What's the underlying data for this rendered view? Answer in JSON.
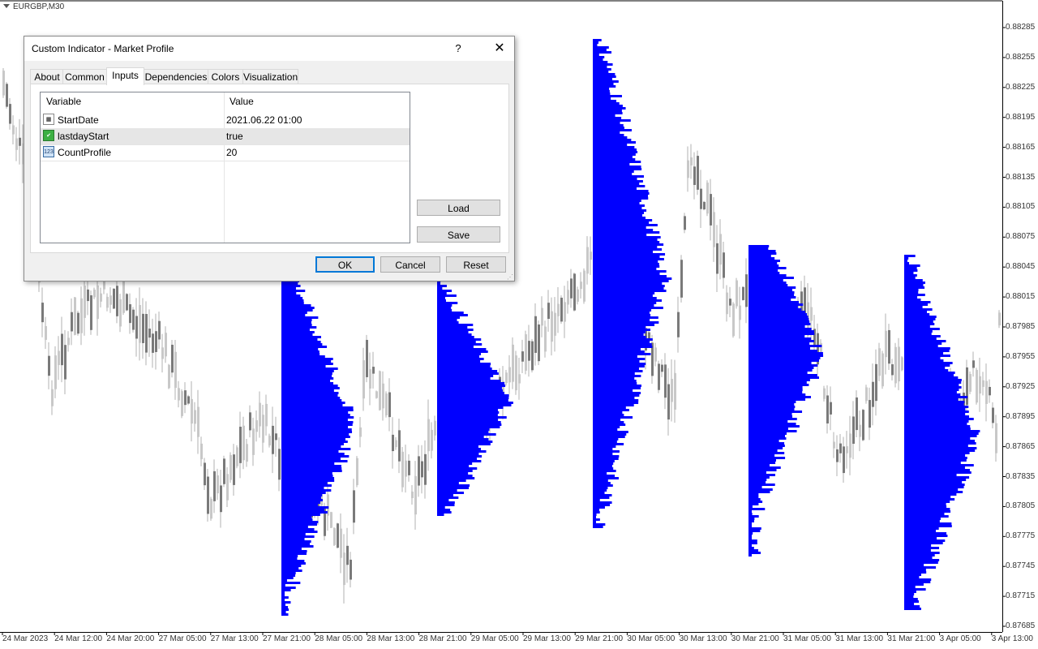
{
  "chart": {
    "symbol": "EURGBP,M30",
    "price_axis": [
      "0.88285",
      "0.88255",
      "0.88225",
      "0.88195",
      "0.88165",
      "0.88135",
      "0.88105",
      "0.88075",
      "0.88045",
      "0.88015",
      "0.87985",
      "0.87955",
      "0.87925",
      "0.87895",
      "0.87865",
      "0.87835",
      "0.87805",
      "0.87775",
      "0.87745",
      "0.87715",
      "0.87685"
    ],
    "time_axis": [
      "24 Mar 2023",
      "24 Mar 12:00",
      "24 Mar 20:00",
      "27 Mar 05:00",
      "27 Mar 13:00",
      "27 Mar 21:00",
      "28 Mar 05:00",
      "28 Mar 13:00",
      "28 Mar 21:00",
      "29 Mar 05:00",
      "29 Mar 13:00",
      "29 Mar 21:00",
      "30 Mar 05:00",
      "30 Mar 13:00",
      "30 Mar 21:00",
      "31 Mar 05:00",
      "31 Mar 13:00",
      "31 Mar 21:00",
      "3 Apr 05:00",
      "3 Apr 13:00"
    ],
    "colors": {
      "candle": "#808080",
      "profile": "#0000ff",
      "axis": "#000000"
    }
  },
  "dialog": {
    "title": "Custom Indicator - Market Profile",
    "help": "?",
    "close": "✕",
    "tabs": [
      "About",
      "Common",
      "Inputs",
      "Dependencies",
      "Colors",
      "Visualization"
    ],
    "active_tab": "Inputs",
    "columns": {
      "variable": "Variable",
      "value": "Value"
    },
    "rows": [
      {
        "variable": "StartDate",
        "value": "2021.06.22 01:00",
        "icon": "calendar-icon"
      },
      {
        "variable": "lastdayStart",
        "value": "true",
        "icon": "boolean-icon"
      },
      {
        "variable": "CountProfile",
        "value": "20",
        "icon": "number-icon"
      }
    ],
    "buttons": {
      "load": "Load",
      "save": "Save",
      "ok": "OK",
      "cancel": "Cancel",
      "reset": "Reset"
    }
  }
}
